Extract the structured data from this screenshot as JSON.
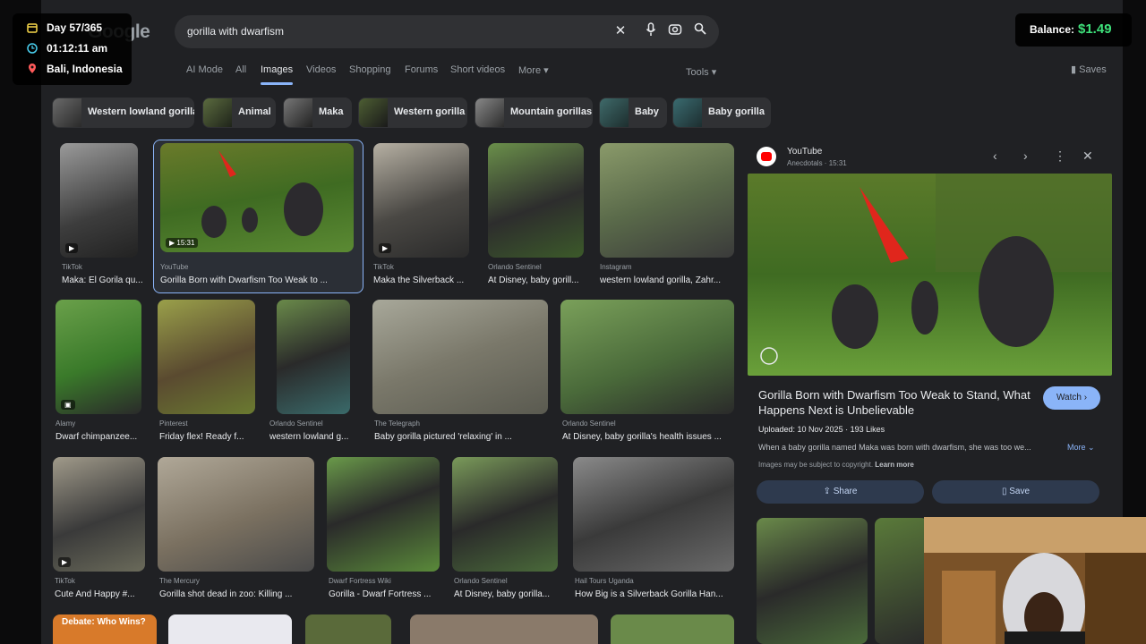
{
  "hud": {
    "day": "Day 57/365",
    "time": "01:12:11 am",
    "location": "Bali, Indonesia"
  },
  "balance": {
    "label": "Balance:",
    "amount": "$1.49"
  },
  "logo": "Google",
  "search": {
    "query": "gorilla with dwarfism"
  },
  "tabs": [
    "AI Mode",
    "All",
    "Images",
    "Videos",
    "Shopping",
    "Forums",
    "Short videos",
    "More"
  ],
  "active_tab": "Images",
  "tools": "Tools",
  "saves": "Saves",
  "chips": [
    "Western lowland gorilla",
    "Animal",
    "Maka",
    "Western gorilla",
    "Mountain gorillas",
    "Baby",
    "Baby gorilla"
  ],
  "results": [
    {
      "source": "TikTok",
      "title": "Maka: El Gorila qu..."
    },
    {
      "source": "YouTube",
      "title": "Gorilla Born with Dwarfism Too Weak to ...",
      "badge": "15:31"
    },
    {
      "source": "TikTok",
      "title": "Maka the Silverback ..."
    },
    {
      "source": "Orlando Sentinel",
      "title": "At Disney, baby gorill..."
    },
    {
      "source": "Instagram",
      "title": "western lowland gorilla, Zahr..."
    },
    {
      "source": "Alamy",
      "title": "Dwarf chimpanzee..."
    },
    {
      "source": "Pinterest",
      "title": "Friday flex! Ready f..."
    },
    {
      "source": "Orlando Sentinel",
      "title": "western lowland g..."
    },
    {
      "source": "The Telegraph",
      "title": "Baby gorilla pictured 'relaxing' in ..."
    },
    {
      "source": "Orlando Sentinel",
      "title": "At Disney, baby gorilla's health issues ..."
    },
    {
      "source": "TikTok",
      "title": "Cute And Happy #..."
    },
    {
      "source": "The Mercury",
      "title": "Gorilla shot dead in zoo: Killing ..."
    },
    {
      "source": "Dwarf Fortress Wiki",
      "title": "Gorilla - Dwarf Fortress ..."
    },
    {
      "source": "Orlando Sentinel",
      "title": "At Disney, baby gorilla..."
    },
    {
      "source": "Hail Tours Uganda",
      "title": "How Big is a Silverback Gorilla Han..."
    }
  ],
  "bottom_row": {
    "debate_label": "Debate: Who Wins?"
  },
  "panel": {
    "source_name": "YouTube",
    "source_sub": "Anecdotals · 15:31",
    "title": "Gorilla Born with Dwarfism Too Weak to Stand, What Happens Next is Unbelievable",
    "watch": "Watch",
    "meta": "Uploaded: 10 Nov 2025 · 193 Likes",
    "desc": "When a baby gorilla named Maka was born with dwarfism, she was too we...",
    "more": "More",
    "copyright": "Images may be subject to copyright.",
    "learn_more": "Learn more",
    "share": "Share",
    "save": "Save"
  }
}
